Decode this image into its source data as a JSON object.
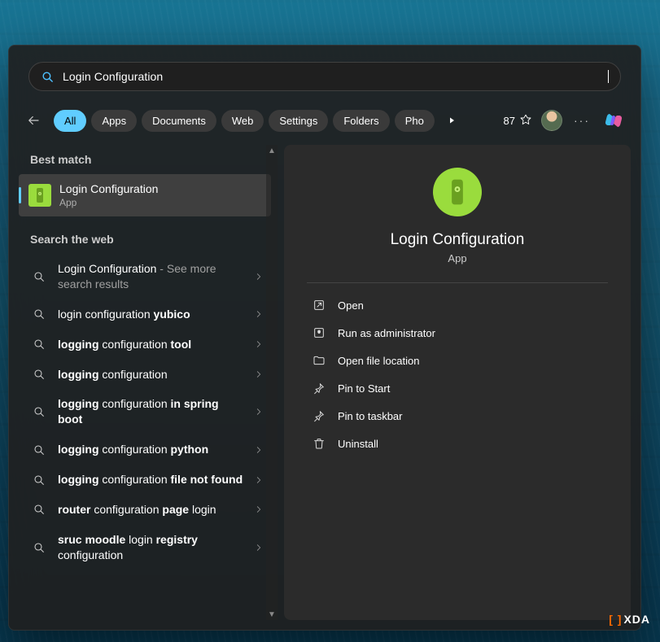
{
  "search": {
    "query": "Login Configuration",
    "icon": "search-icon"
  },
  "filters": {
    "chips": [
      "All",
      "Apps",
      "Documents",
      "Web",
      "Settings",
      "Folders",
      "Pho"
    ],
    "active_index": 0,
    "points": "87"
  },
  "sections": {
    "best_match_label": "Best match",
    "search_web_label": "Search the web"
  },
  "best_match": {
    "title": "Login Configuration",
    "subtitle": "App"
  },
  "web_results": [
    {
      "parts": [
        "Login Configuration",
        " - See more search results"
      ],
      "bold": [],
      "muted_tail": true
    },
    {
      "parts": [
        "login configuration ",
        "yubico"
      ],
      "bold": [
        1
      ]
    },
    {
      "parts": [
        "logging",
        " configuration ",
        "tool"
      ],
      "bold": [
        0,
        2
      ]
    },
    {
      "parts": [
        "logging",
        " configuration"
      ],
      "bold": [
        0
      ]
    },
    {
      "parts": [
        "logging",
        " configuration ",
        "in spring boot"
      ],
      "bold": [
        0,
        2
      ]
    },
    {
      "parts": [
        "logging",
        " configuration ",
        "python"
      ],
      "bold": [
        0,
        2
      ]
    },
    {
      "parts": [
        "logging",
        " configuration ",
        "file not found"
      ],
      "bold": [
        0,
        2
      ]
    },
    {
      "parts": [
        "router",
        " configuration ",
        "page",
        " login"
      ],
      "bold": [
        0,
        2
      ]
    },
    {
      "parts": [
        "sruc moodle",
        " login ",
        "registry",
        " configuration"
      ],
      "bold": [
        0,
        2
      ]
    }
  ],
  "detail": {
    "title": "Login Configuration",
    "type": "App",
    "actions": [
      {
        "icon": "open-icon",
        "label": "Open"
      },
      {
        "icon": "admin-icon",
        "label": "Run as administrator"
      },
      {
        "icon": "folder-icon",
        "label": "Open file location"
      },
      {
        "icon": "pin-start-icon",
        "label": "Pin to Start"
      },
      {
        "icon": "pin-taskbar-icon",
        "label": "Pin to taskbar"
      },
      {
        "icon": "trash-icon",
        "label": "Uninstall"
      }
    ]
  },
  "watermark": "XDA"
}
